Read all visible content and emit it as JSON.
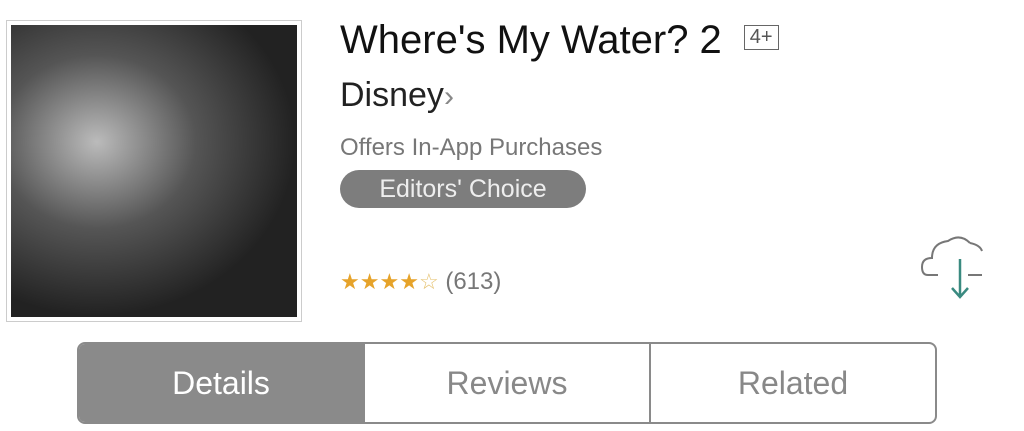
{
  "app": {
    "title": "Where's My Water? 2",
    "age_rating": "4+",
    "developer": "Disney",
    "developer_chevron": "›",
    "iap_notice": "Offers In-App Purchases",
    "badge": "Editors' Choice",
    "rating": {
      "stars": 4,
      "max": 5,
      "count": "(613)"
    },
    "star_color": "#e6a32a",
    "download_icon": "cloud-download-icon"
  },
  "tabs": [
    {
      "label": "Details",
      "selected": true
    },
    {
      "label": "Reviews",
      "selected": false
    },
    {
      "label": "Related",
      "selected": false
    }
  ]
}
